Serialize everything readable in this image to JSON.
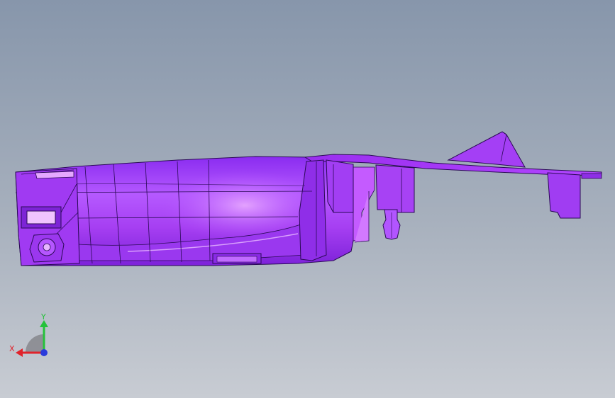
{
  "viewport": {
    "background_top": "#8796ab",
    "background_bottom": "#c8ccd3"
  },
  "model": {
    "surface_color": "#a93cf5",
    "highlight_color": "#d07bff",
    "shadow_color": "#6d1fd0",
    "edge_color": "#2a0a55"
  },
  "triad": {
    "x_label": "X",
    "y_label": "Y",
    "x_color": "#e0232b",
    "y_color": "#25c23a",
    "z_color": "#2a3bdb"
  }
}
